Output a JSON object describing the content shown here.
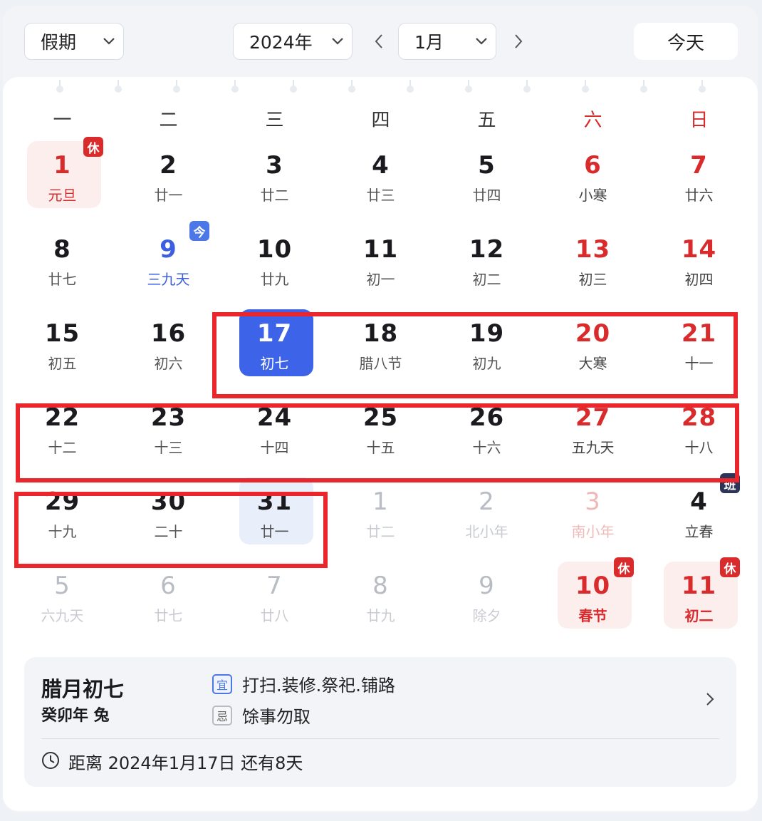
{
  "toolbar": {
    "holiday_select": "假期",
    "year_select": "2024年",
    "month_select": "1月",
    "today_button": "今天"
  },
  "weekdays": [
    "一",
    "二",
    "三",
    "四",
    "五",
    "六",
    "日"
  ],
  "badges": {
    "rest": "休",
    "today": "今",
    "work": "班"
  },
  "weeks": [
    [
      {
        "d": "1",
        "l": "元旦",
        "k": "holiday",
        "badge": "rest"
      },
      {
        "d": "2",
        "l": "廿一"
      },
      {
        "d": "3",
        "l": "廿二"
      },
      {
        "d": "4",
        "l": "廿三"
      },
      {
        "d": "5",
        "l": "廿四"
      },
      {
        "d": "6",
        "l": "小寒",
        "k": "weekend"
      },
      {
        "d": "7",
        "l": "廿六",
        "k": "weekend"
      }
    ],
    [
      {
        "d": "8",
        "l": "廿七"
      },
      {
        "d": "9",
        "l": "三九天",
        "k": "today",
        "badge": "today"
      },
      {
        "d": "10",
        "l": "廿九"
      },
      {
        "d": "11",
        "l": "初一"
      },
      {
        "d": "12",
        "l": "初二"
      },
      {
        "d": "13",
        "l": "初三",
        "k": "weekend"
      },
      {
        "d": "14",
        "l": "初四",
        "k": "weekend"
      }
    ],
    [
      {
        "d": "15",
        "l": "初五"
      },
      {
        "d": "16",
        "l": "初六"
      },
      {
        "d": "17",
        "l": "初七",
        "k": "selected"
      },
      {
        "d": "18",
        "l": "腊八节"
      },
      {
        "d": "19",
        "l": "初九"
      },
      {
        "d": "20",
        "l": "大寒",
        "k": "weekend"
      },
      {
        "d": "21",
        "l": "十一",
        "k": "weekend"
      }
    ],
    [
      {
        "d": "22",
        "l": "十二"
      },
      {
        "d": "23",
        "l": "十三"
      },
      {
        "d": "24",
        "l": "十四"
      },
      {
        "d": "25",
        "l": "十五"
      },
      {
        "d": "26",
        "l": "十六"
      },
      {
        "d": "27",
        "l": "五九天",
        "k": "weekend"
      },
      {
        "d": "28",
        "l": "十八",
        "k": "weekend"
      }
    ],
    [
      {
        "d": "29",
        "l": "十九"
      },
      {
        "d": "30",
        "l": "二十"
      },
      {
        "d": "31",
        "l": "廿一",
        "k": "hl"
      },
      {
        "d": "1",
        "l": "廿二",
        "k": "other"
      },
      {
        "d": "2",
        "l": "北小年",
        "k": "other"
      },
      {
        "d": "3",
        "l": "南小年",
        "k": "other faded-red"
      },
      {
        "d": "4",
        "l": "立春",
        "k": "other work",
        "badge": "work"
      }
    ],
    [
      {
        "d": "5",
        "l": "六九天",
        "k": "other"
      },
      {
        "d": "6",
        "l": "廿七",
        "k": "other"
      },
      {
        "d": "7",
        "l": "廿八",
        "k": "other"
      },
      {
        "d": "8",
        "l": "廿九",
        "k": "other"
      },
      {
        "d": "9",
        "l": "除夕",
        "k": "other"
      },
      {
        "d": "10",
        "l": "春节",
        "k": "other holiday",
        "badge": "rest"
      },
      {
        "d": "11",
        "l": "初二",
        "k": "other holiday",
        "badge": "rest"
      }
    ]
  ],
  "info": {
    "lunar_date": "腊月初七",
    "ganzhi": "癸卯年 兔",
    "yi_tag": "宜",
    "yi": "打扫.装修.祭祀.铺路",
    "ji_tag": "忌",
    "ji": "馀事勿取",
    "countdown": "距离 2024年1月17日 还有8天"
  },
  "colors": {
    "accent": "#3d63e8",
    "holiday_red": "#d92b2b",
    "highlight_frame": "#e8262b"
  }
}
